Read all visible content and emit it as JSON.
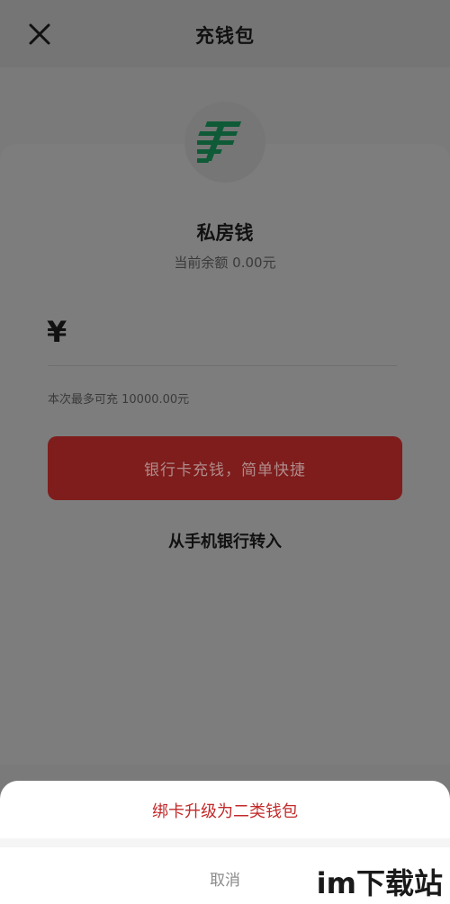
{
  "header": {
    "title": "充钱包",
    "close_icon": "close-icon"
  },
  "wallet": {
    "logo_icon": "china-post-logo-icon",
    "name": "私房钱",
    "balance_text": "当前余额 0.00元"
  },
  "recharge": {
    "currency_symbol": "¥",
    "amount_value": "",
    "limit_hint": "本次最多可充 10000.00元",
    "primary_button": "银行卡充钱，简单快捷",
    "secondary_link": "从手机银行转入"
  },
  "action_sheet": {
    "option_upgrade": "绑卡升级为二类钱包",
    "option_cancel": "取消"
  },
  "watermark": {
    "text": "im下载站"
  },
  "colors": {
    "overlay": "#7a7a7a",
    "primary_button": "#7e1d1c",
    "accent_red": "#c32a2a",
    "logo_green": "#0f5a37"
  }
}
